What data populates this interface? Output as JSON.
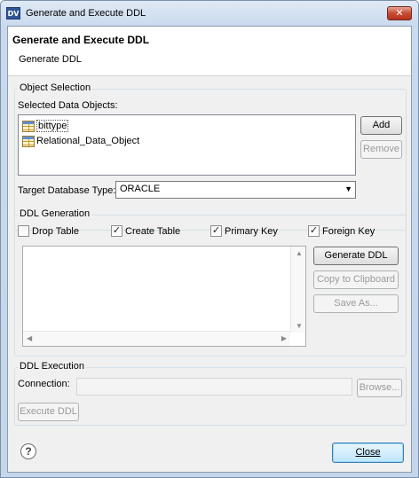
{
  "window": {
    "title": "Generate and Execute DDL",
    "app_icon": "DV"
  },
  "header": {
    "title": "Generate and Execute DDL",
    "subtitle": "Generate DDL"
  },
  "object_selection": {
    "group_label": "Object Selection",
    "list_label": "Selected Data Objects:",
    "items": [
      "bittype",
      "Relational_Data_Object"
    ],
    "add_label": "Add",
    "remove_label": "Remove",
    "target_label": "Target Database Type:",
    "target_value": "ORACLE"
  },
  "ddl_generation": {
    "group_label": "DDL Generation",
    "options": [
      {
        "label": "Drop Table",
        "checked": false
      },
      {
        "label": "Create Table",
        "checked": true
      },
      {
        "label": "Primary Key",
        "checked": true
      },
      {
        "label": "Foreign Key",
        "checked": true
      }
    ],
    "generate_label": "Generate DDL",
    "copy_label": "Copy to Clipboard",
    "save_label": "Save As..."
  },
  "ddl_execution": {
    "group_label": "DDL Execution",
    "connection_label": "Connection:",
    "connection_value": "",
    "browse_label": "Browse...",
    "execute_label": "Execute DDL"
  },
  "footer": {
    "close_label": "Close"
  },
  "icons": {
    "check_glyph": "✓",
    "dropdown_glyph": "▼",
    "help_glyph": "?"
  }
}
